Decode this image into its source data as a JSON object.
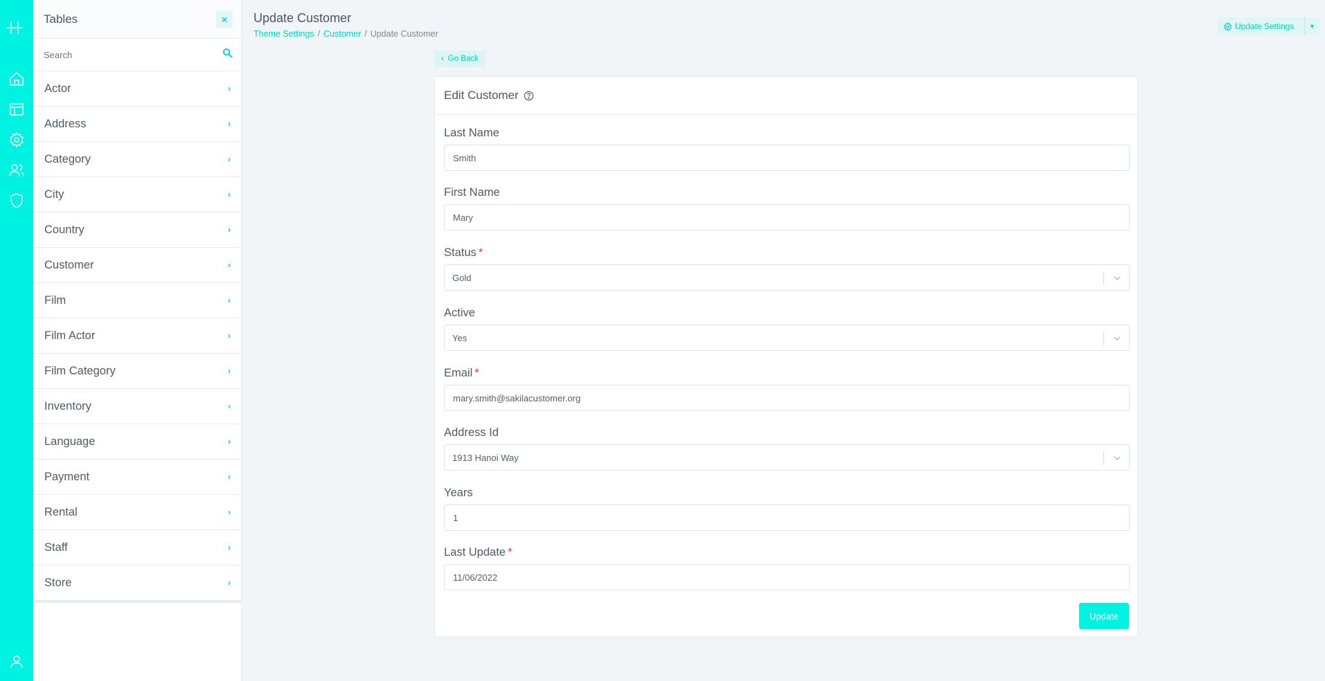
{
  "rail": {
    "icons": [
      "logo-icon",
      "home-icon",
      "table-icon",
      "settings-icon",
      "users-icon",
      "shield-icon",
      "user-icon"
    ]
  },
  "tables": {
    "title": "Tables",
    "close_label": "×",
    "search_placeholder": "Search",
    "items": [
      {
        "label": "Actor"
      },
      {
        "label": "Address"
      },
      {
        "label": "Category"
      },
      {
        "label": "City"
      },
      {
        "label": "Country"
      },
      {
        "label": "Customer"
      },
      {
        "label": "Film"
      },
      {
        "label": "Film Actor"
      },
      {
        "label": "Film Category"
      },
      {
        "label": "Inventory"
      },
      {
        "label": "Language"
      },
      {
        "label": "Payment"
      },
      {
        "label": "Rental"
      },
      {
        "label": "Staff"
      },
      {
        "label": "Store"
      }
    ]
  },
  "header": {
    "title": "Update Customer",
    "breadcrumb": [
      "Theme Settings",
      "Customer",
      "Update Customer"
    ],
    "settings_label": "Update Settings"
  },
  "go_back": "Go Back",
  "form": {
    "title": "Edit Customer",
    "fields": {
      "last_name": {
        "label": "Last Name",
        "value": "Smith"
      },
      "first_name": {
        "label": "First Name",
        "value": "Mary"
      },
      "status": {
        "label": "Status",
        "value": "Gold",
        "required": "*"
      },
      "active": {
        "label": "Active",
        "value": "Yes"
      },
      "email": {
        "label": "Email",
        "value": "mary.smith@sakilacustomer.org",
        "required": "*"
      },
      "address_id": {
        "label": "Address Id",
        "value": "1913 Hanoi Way"
      },
      "years": {
        "label": "Years",
        "value": "1"
      },
      "last_update": {
        "label": "Last Update",
        "value": "11/06/2022",
        "required": "*"
      }
    },
    "submit_label": "Update"
  },
  "colors": {
    "accent": "#00f2e2",
    "accent_text": "#00d4c6",
    "required": "#e8334f",
    "background": "#f1f5f8"
  }
}
